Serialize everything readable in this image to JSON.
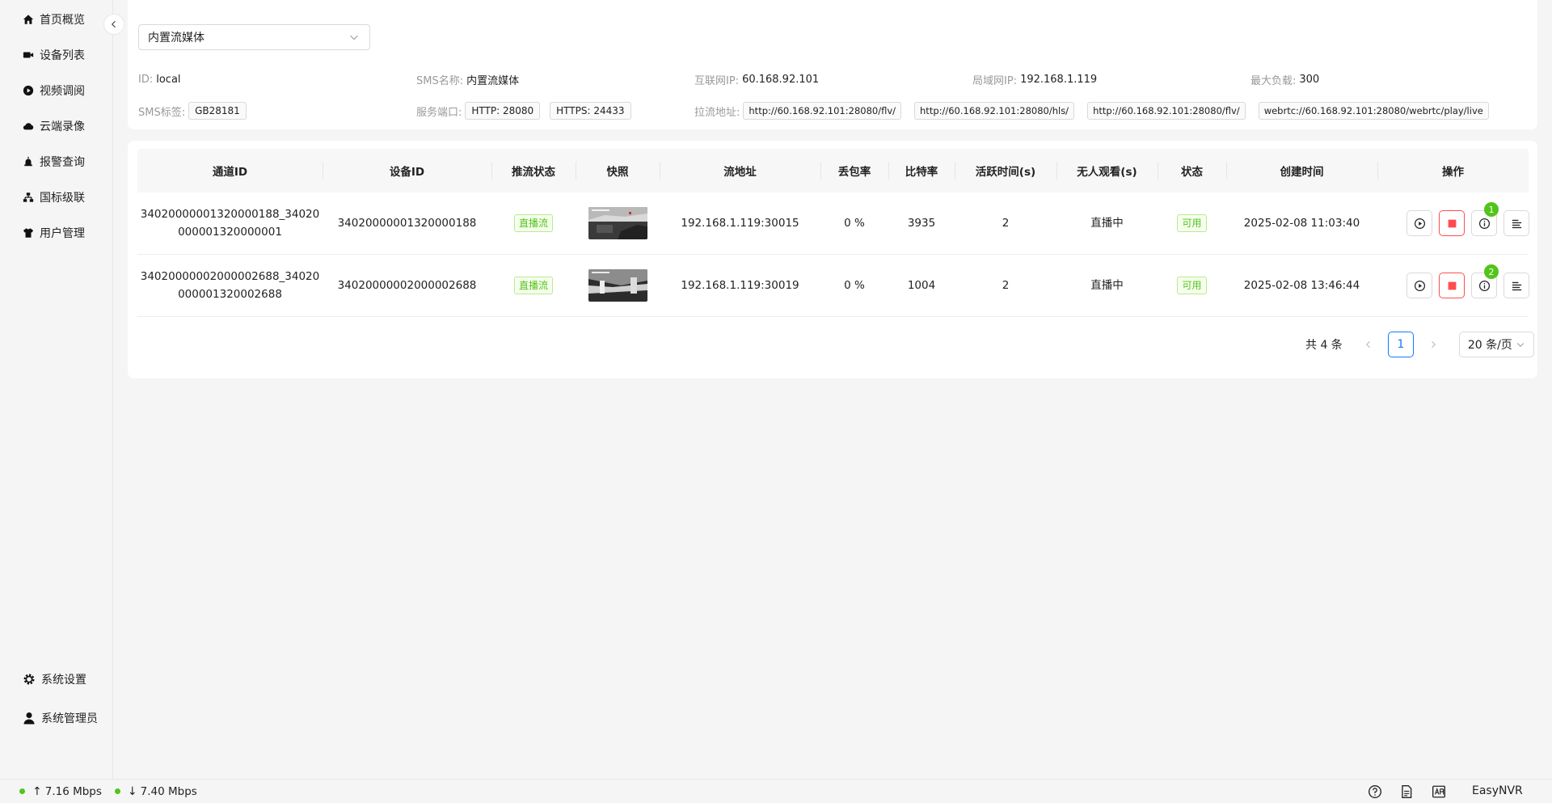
{
  "sidebar": {
    "items": [
      {
        "label": "首页概览",
        "icon": "home-icon"
      },
      {
        "label": "设备列表",
        "icon": "camera-icon"
      },
      {
        "label": "视频调阅",
        "icon": "play-circle-icon"
      },
      {
        "label": "云端录像",
        "icon": "cloud-icon"
      },
      {
        "label": "报警查询",
        "icon": "alarm-icon"
      },
      {
        "label": "国标级联",
        "icon": "cascade-icon"
      },
      {
        "label": "用户管理",
        "icon": "user-manage-icon"
      }
    ],
    "bottom": [
      {
        "label": "系统设置",
        "icon": "gear-icon"
      },
      {
        "label": "系统管理员",
        "icon": "user-icon"
      }
    ]
  },
  "info": {
    "select_value": "内置流媒体",
    "id_label": "ID:",
    "id_value": "local",
    "sms_name_label": "SMS名称:",
    "sms_name_value": "内置流媒体",
    "public_ip_label": "互联网IP:",
    "public_ip_value": "60.168.92.101",
    "lan_ip_label": "局域网IP:",
    "lan_ip_value": "192.168.1.119",
    "max_load_label": "最大负载:",
    "max_load_value": "300",
    "sms_tag_label": "SMS标签:",
    "sms_tag_value": "GB28181",
    "port_label": "服务端口:",
    "http_port": "HTTP: 28080",
    "https_port": "HTTPS: 24433",
    "pull_label": "拉流地址:",
    "pull_urls": [
      "http://60.168.92.101:28080/flv/",
      "http://60.168.92.101:28080/hls/",
      "http://60.168.92.101:28080/flv/",
      "webrtc://60.168.92.101:28080/webrtc/play/live"
    ]
  },
  "table": {
    "headers": [
      "通道ID",
      "设备ID",
      "推流状态",
      "快照",
      "流地址",
      "丢包率",
      "比特率",
      "活跃时间(s)",
      "无人观看(s)",
      "状态",
      "创建时间",
      "操作"
    ],
    "rows": [
      {
        "channel_id_1": "34020000001320000188_34020",
        "channel_id_2": "000001320000001",
        "device_id": "34020000001320000188",
        "push_status": "直播流",
        "stream_addr": "192.168.1.119:30015",
        "loss": "0 %",
        "bitrate": "3935",
        "active": "2",
        "idle": "直播中",
        "status": "可用",
        "created": "2025-02-08 11:03:40",
        "badge": "1"
      },
      {
        "channel_id_1": "34020000002000002688_34020",
        "channel_id_2": "000001320002688",
        "device_id": "34020000002000002688",
        "push_status": "直播流",
        "stream_addr": "192.168.1.119:30019",
        "loss": "0 %",
        "bitrate": "1004",
        "active": "2",
        "idle": "直播中",
        "status": "可用",
        "created": "2025-02-08 13:46:44",
        "badge": "2"
      }
    ]
  },
  "pagination": {
    "total": "共 4 条",
    "current": "1",
    "page_size": "20 条/页"
  },
  "statusbar": {
    "upload": "7.16 Mbps",
    "download": "7.40 Mbps",
    "app_name": "EasyNVR"
  },
  "colors": {
    "accent": "#1677ff",
    "success": "#52c41a",
    "danger": "#ff4d4f"
  }
}
